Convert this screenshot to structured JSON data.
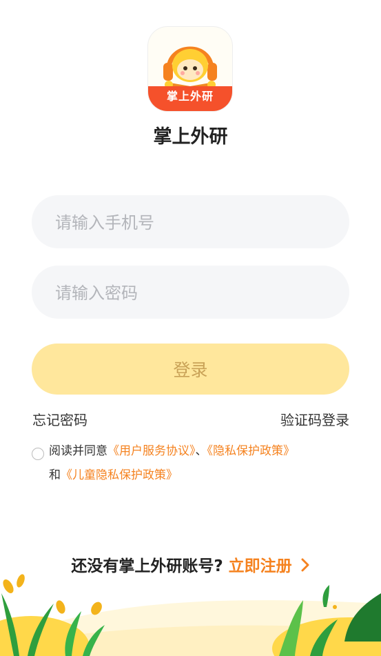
{
  "app": {
    "logo_text": "掌上外研",
    "name": "掌上外研"
  },
  "form": {
    "phone_placeholder": "请输入手机号",
    "password_placeholder": "请输入密码",
    "login_label": "登录"
  },
  "links": {
    "forgot_password": "忘记密码",
    "sms_login": "验证码登录"
  },
  "agreement": {
    "prefix": "阅读并同意",
    "user_agreement": "《用户服务协议》",
    "separator": "、",
    "privacy_policy": "《隐私保护政策》",
    "and": "和",
    "child_privacy_policy": "《儿童隐私保护政策》"
  },
  "register": {
    "prompt": "还没有掌上外研账号?",
    "link": "立即注册",
    "chevron_icon": "chevron-right-icon"
  },
  "colors": {
    "accent": "#f5821f",
    "login_button_bg": "#ffe79c",
    "login_button_text": "#c9a257",
    "logo_band": "#f5512b"
  }
}
